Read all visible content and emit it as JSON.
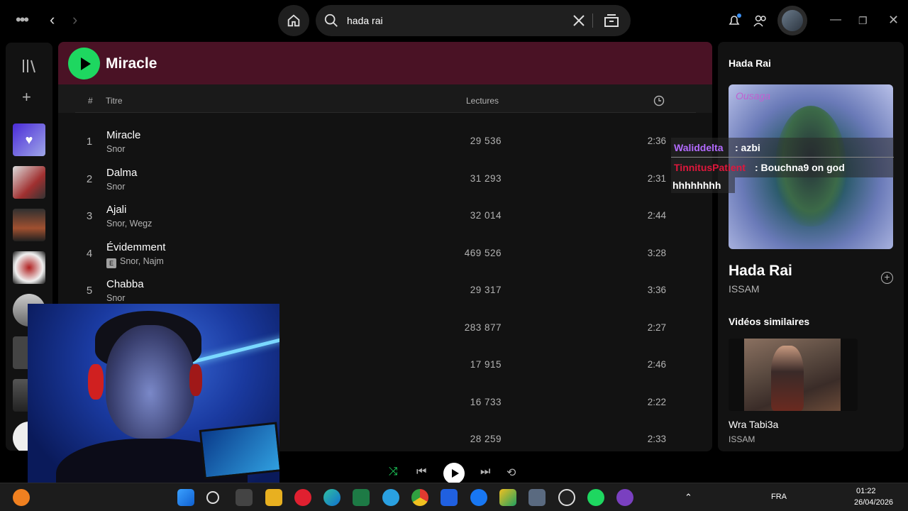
{
  "topbar": {
    "search_value": "hada rai",
    "icons": [
      "more-icon",
      "back-icon",
      "forward-icon",
      "home-icon",
      "search-icon",
      "clear-icon",
      "browse-icon",
      "bell-icon",
      "friends-icon",
      "minimize-icon",
      "maximize-icon",
      "close-icon"
    ]
  },
  "playlist": {
    "title": "Miracle",
    "columns": {
      "num": "#",
      "title": "Titre",
      "plays": "Lectures"
    },
    "tracks": [
      {
        "num": "1",
        "title": "Miracle",
        "artist": "Snor",
        "plays": "29 536",
        "duration": "2:36",
        "explicit": false
      },
      {
        "num": "2",
        "title": "Dalma",
        "artist": "Snor",
        "plays": "31 293",
        "duration": "2:31",
        "explicit": false
      },
      {
        "num": "3",
        "title": "Ajali",
        "artist": "Snor, Wegz",
        "plays": "32 014",
        "duration": "2:44",
        "explicit": false
      },
      {
        "num": "4",
        "title": "Évidemment",
        "artist": "Snor, Najm",
        "plays": "469 526",
        "duration": "3:28",
        "explicit": true
      },
      {
        "num": "5",
        "title": "Chabba",
        "artist": "Snor",
        "plays": "29 317",
        "duration": "3:36",
        "explicit": false
      },
      {
        "num": "",
        "title": "",
        "artist": "",
        "plays": "283 877",
        "duration": "2:27",
        "explicit": false
      },
      {
        "num": "",
        "title": "",
        "artist": "",
        "plays": "17 915",
        "duration": "2:46",
        "explicit": false
      },
      {
        "num": "",
        "title": "",
        "artist": "",
        "plays": "16 733",
        "duration": "2:22",
        "explicit": false
      },
      {
        "num": "",
        "title": "",
        "artist": "",
        "plays": "28 259",
        "duration": "2:33",
        "explicit": false
      }
    ]
  },
  "now_playing": {
    "header": "Hada Rai",
    "title": "Hada Rai",
    "artist": "ISSAM",
    "similar_header": "Vidéos similaires",
    "video_title": "Wra Tabi3a",
    "video_artist": "ISSAM",
    "cover_logo": "Ousaga"
  },
  "chat": [
    {
      "user": "Waliddelta",
      "user_color": "#b36bff",
      "message": " : azbi"
    },
    {
      "user": "TinnitusPatient",
      "user_color": "#e0173c",
      "message": " : Bouchna9 on god"
    }
  ],
  "chat_wrap": "hhhhhhhh",
  "explicit_badge": "E",
  "taskbar": {
    "lang": "FRA",
    "time": "01:22",
    "date": "26/04/2026"
  },
  "colors": {
    "accent": "#1ed760",
    "header_bg": "#4a1225"
  }
}
